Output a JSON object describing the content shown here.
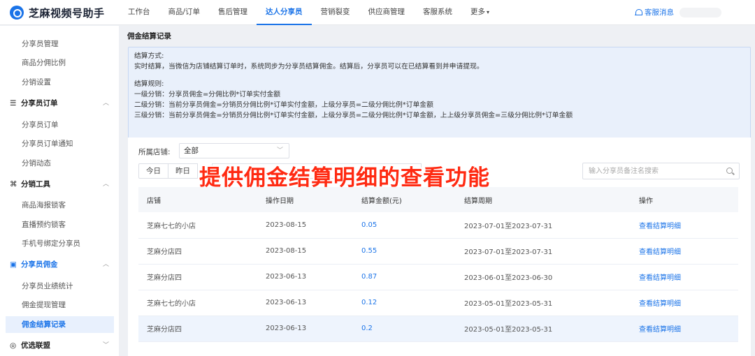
{
  "app": {
    "name": "芝麻视频号助手"
  },
  "topnav": [
    {
      "label": "工作台"
    },
    {
      "label": "商品/订单"
    },
    {
      "label": "售后管理"
    },
    {
      "label": "达人分享员",
      "active": true
    },
    {
      "label": "营销裂变"
    },
    {
      "label": "供应商管理"
    },
    {
      "label": "客服系统"
    },
    {
      "label": "更多"
    }
  ],
  "notify": {
    "label": "客服消息"
  },
  "sidebar": {
    "items": [
      {
        "label": "分享员管理"
      },
      {
        "label": "商品分佣比例"
      },
      {
        "label": "分销设置"
      },
      {
        "label": "分享员订单",
        "group": true,
        "icon": "list-icon"
      },
      {
        "label": "分享员订单"
      },
      {
        "label": "分享员订单通知"
      },
      {
        "label": "分销动态"
      },
      {
        "label": "分销工具",
        "group": true,
        "icon": "tools-icon"
      },
      {
        "label": "商品海报锁客"
      },
      {
        "label": "直播预约锁客"
      },
      {
        "label": "手机号绑定分享员"
      },
      {
        "label": "分享员佣金",
        "group": true,
        "icon": "commission-icon",
        "active": true
      },
      {
        "label": "分享员业绩统计"
      },
      {
        "label": "佣金提现管理"
      },
      {
        "label": "佣金结算记录",
        "active": true
      },
      {
        "label": "优选联盟",
        "group": true,
        "icon": "union-icon"
      }
    ]
  },
  "page": {
    "title": "佣金结算记录",
    "info": {
      "method_label": "结算方式:",
      "method_text": "实时结算，当微信为店铺结算订单时，系统同步为分享员结算佣金。结算后，分享员可以在已结算看到并申请提现。",
      "rules_label": "结算规则:",
      "rule1": "一级分销：分享员佣金=分佣比例*订单实付金额",
      "rule2": "二级分销：当前分享员佣金=分销员分佣比例*订单实付金额，上级分享员=二级分佣比例*订单金额",
      "rule3": "三级分销：当前分享员佣金=分销员分佣比例*订单实付金额，上级分享员=二级分佣比例*订单金额，上上级分享员佣金=三级分佣比例*订单金额"
    },
    "filter": {
      "store_label": "所属店铺:",
      "store_value": "全部",
      "today": "今日",
      "yesterday": "昨日",
      "search_placeholder": "输入分享员备注名搜索"
    },
    "overlay": "提供佣金结算明细的查看功能",
    "table": {
      "headers": [
        "店铺",
        "操作日期",
        "结算金额(元)",
        "结算周期",
        "操作"
      ],
      "rows": [
        {
          "store": "芝麻七七的小店",
          "date": "2023-08-15",
          "amount": "0.05",
          "period": "2023-07-01至2023-07-31",
          "action": "查看结算明细"
        },
        {
          "store": "芝麻分店四",
          "date": "2023-08-15",
          "amount": "0.55",
          "period": "2023-07-01至2023-07-31",
          "action": "查看结算明细"
        },
        {
          "store": "芝麻分店四",
          "date": "2023-06-13",
          "amount": "0.87",
          "period": "2023-06-01至2023-06-30",
          "action": "查看结算明细"
        },
        {
          "store": "芝麻七七的小店",
          "date": "2023-06-13",
          "amount": "0.12",
          "period": "2023-05-01至2023-05-31",
          "action": "查看结算明细"
        },
        {
          "store": "芝麻分店四",
          "date": "2023-06-13",
          "amount": "0.2",
          "period": "2023-05-01至2023-05-31",
          "action": "查看结算明细"
        }
      ]
    }
  }
}
